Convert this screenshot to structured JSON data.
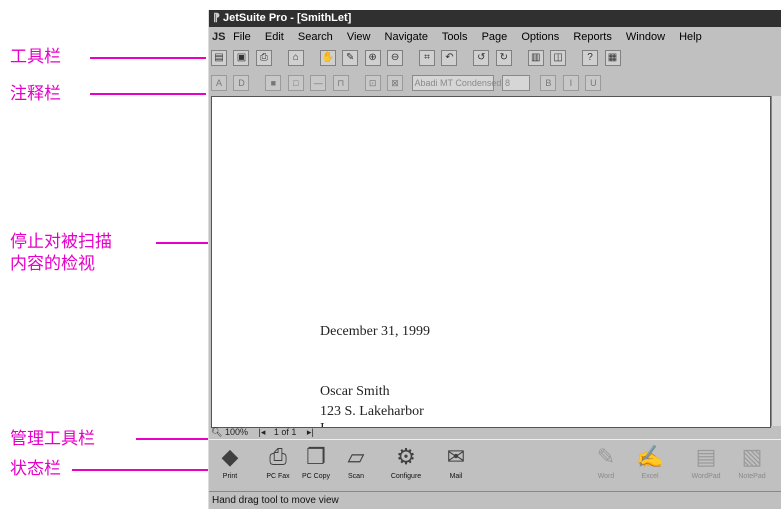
{
  "callouts": {
    "toolbar": "工具栏",
    "annotation_bar": "注释栏",
    "stop_view_line1": "停止对被扫描",
    "stop_view_line2": "内容的检视",
    "management_bar": "管理工具栏",
    "status_bar": "状态栏"
  },
  "window": {
    "title": "JetSuite Pro - [SmithLet]",
    "menu": [
      "File",
      "Edit",
      "Search",
      "View",
      "Navigate",
      "Tools",
      "Page",
      "Options",
      "Reports",
      "Window",
      "Help"
    ]
  },
  "annotation": {
    "font_name": "Abadi MT Condensed Li",
    "font_size": "8"
  },
  "document": {
    "date": "December 31, 1999",
    "name": "Oscar Smith",
    "address": "123 S. Lakeharbor",
    "partial": "I"
  },
  "doc_status": {
    "zoom": "100%",
    "page": "1 of 1"
  },
  "management_buttons": [
    {
      "label": "Print",
      "icon": "printer-icon"
    },
    {
      "label": "PC Fax",
      "icon": "fax-icon"
    },
    {
      "label": "PC Copy",
      "icon": "copy-icon"
    },
    {
      "label": "Scan",
      "icon": "scanner-icon"
    },
    {
      "label": "Configure",
      "icon": "configure-icon"
    },
    {
      "label": "Mail",
      "icon": "mail-icon"
    },
    {
      "label": "Word",
      "icon": "word-icon"
    },
    {
      "label": "Excel",
      "icon": "excel-icon"
    },
    {
      "label": "WordPad",
      "icon": "wordpad-icon"
    },
    {
      "label": "NotePad",
      "icon": "notepad-icon"
    }
  ],
  "status_bar": {
    "text": "Hand drag tool to move view"
  }
}
